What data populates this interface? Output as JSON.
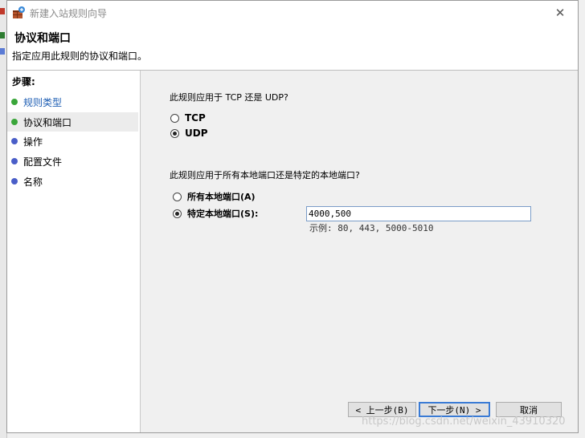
{
  "window": {
    "title": "新建入站规则向导",
    "close_label": "✕"
  },
  "header": {
    "title": "协议和端口",
    "subtitle": "指定应用此规则的协议和端口。"
  },
  "steps": {
    "label": "步骤:",
    "items": [
      {
        "label": "规则类型",
        "status": "done",
        "color": "#3aa63a"
      },
      {
        "label": "协议和端口",
        "status": "current",
        "color": "#3aa63a"
      },
      {
        "label": "操作",
        "status": "pending",
        "color": "#4a5ec8"
      },
      {
        "label": "配置文件",
        "status": "pending",
        "color": "#4a5ec8"
      },
      {
        "label": "名称",
        "status": "pending",
        "color": "#4a5ec8"
      }
    ]
  },
  "protocol": {
    "question": "此规则应用于 TCP 还是 UDP?",
    "options": [
      {
        "label": "TCP",
        "checked": false
      },
      {
        "label": "UDP",
        "checked": true
      }
    ]
  },
  "ports": {
    "question": "此规则应用于所有本地端口还是特定的本地端口?",
    "options": [
      {
        "label": "所有本地端口(A)",
        "checked": false
      },
      {
        "label": "特定本地端口(S):",
        "checked": true
      }
    ],
    "input_value": "4000,500",
    "example": "示例: 80, 443, 5000-5010"
  },
  "buttons": {
    "back": "< 上一步(B)",
    "next": "下一步(N) >",
    "cancel": "取消"
  },
  "watermark": "https://blog.csdn.net/weixin_43910320"
}
